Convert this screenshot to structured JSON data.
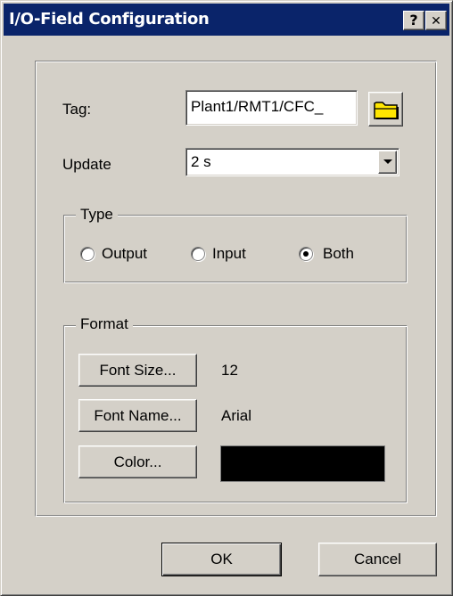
{
  "window": {
    "title": "I/O-Field Configuration",
    "help_label": "?",
    "close_label": "✕"
  },
  "tag": {
    "label": "Tag:",
    "value": "Plant1/RMT1/CFC_",
    "browse_icon": "folder-icon"
  },
  "update": {
    "label": "Update",
    "value": "2 s"
  },
  "type_group": {
    "label": "Type",
    "options": [
      {
        "label": "Output",
        "selected": false
      },
      {
        "label": "Input",
        "selected": false
      },
      {
        "label": "Both",
        "selected": true
      }
    ]
  },
  "format_group": {
    "label": "Format",
    "font_size_button": "Font Size...",
    "font_size_value": "12",
    "font_name_button": "Font Name...",
    "font_name_value": "Arial",
    "color_button": "Color...",
    "color_value": "#000000"
  },
  "footer": {
    "ok_label": "OK",
    "cancel_label": "Cancel"
  },
  "colors": {
    "titlebar": "#0a246a",
    "face": "#d4d0c8",
    "folder": "#ffe600"
  }
}
